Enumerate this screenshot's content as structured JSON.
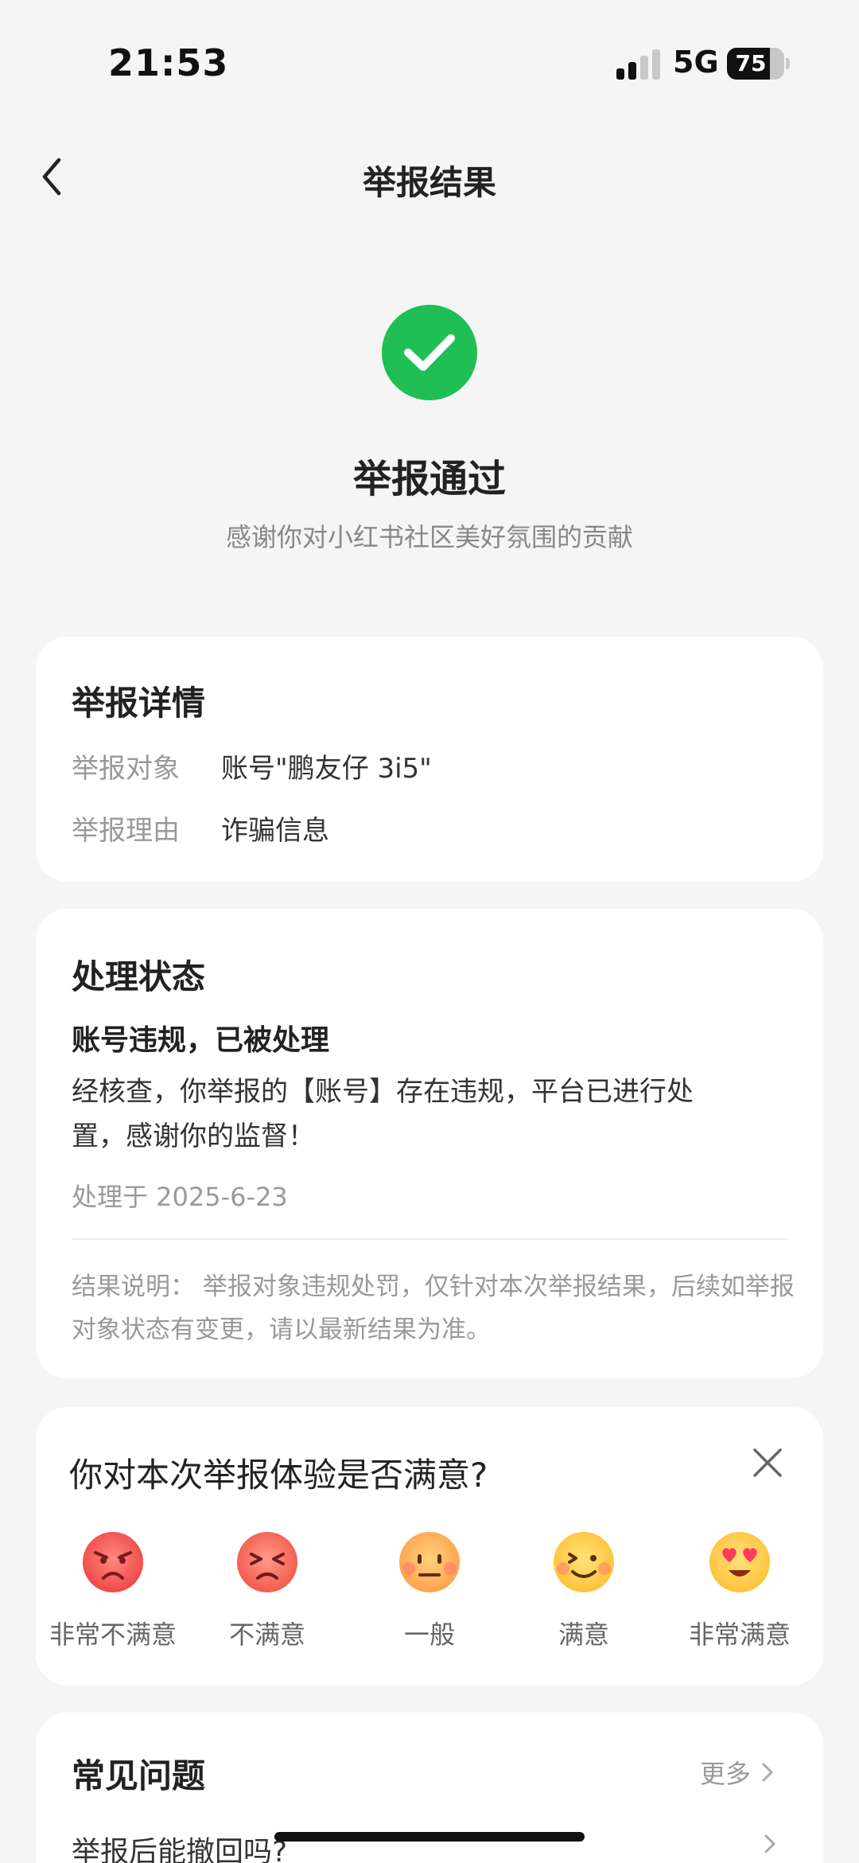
{
  "status_bar": {
    "time": "21:53",
    "network": "5G",
    "battery": "75",
    "battery_level": 0.75
  },
  "nav": {
    "title": "举报结果",
    "back_icon": "chevron-left-icon"
  },
  "result": {
    "icon": "check-circle-icon",
    "icon_color": "#1fbf55",
    "title": "举报通过",
    "subtitle": "感谢你对小红书社区美好氛围的贡献"
  },
  "details": {
    "title": "举报详情",
    "rows": [
      {
        "key": "举报对象",
        "value": "账号\"鹏友仔 3i5\""
      },
      {
        "key": "举报理由",
        "value": "诈骗信息"
      }
    ]
  },
  "status": {
    "title": "处理状态",
    "headline": "账号违规，已被处理",
    "description": "经核查，你举报的【账号】存在违规，平台已进行处置，感谢你的监督！",
    "time": "处理于 2025-6-23",
    "note": "结果说明： 举报对象违规处罚，仅针对本次举报结果，后续如举报对象状态有变更，请以最新结果为准。"
  },
  "survey": {
    "title": "你对本次举报体验是否满意?",
    "close_icon": "close-icon",
    "options": [
      {
        "label": "非常不满意",
        "icon": "very-angry-emoji-icon"
      },
      {
        "label": "不满意",
        "icon": "angry-emoji-icon"
      },
      {
        "label": "一般",
        "icon": "neutral-emoji-icon"
      },
      {
        "label": "满意",
        "icon": "happy-emoji-icon"
      },
      {
        "label": "非常满意",
        "icon": "heart-eyes-emoji-icon"
      }
    ]
  },
  "faq": {
    "title": "常见问题",
    "more": "更多",
    "questions": [
      "举报后能撤回吗?"
    ]
  }
}
